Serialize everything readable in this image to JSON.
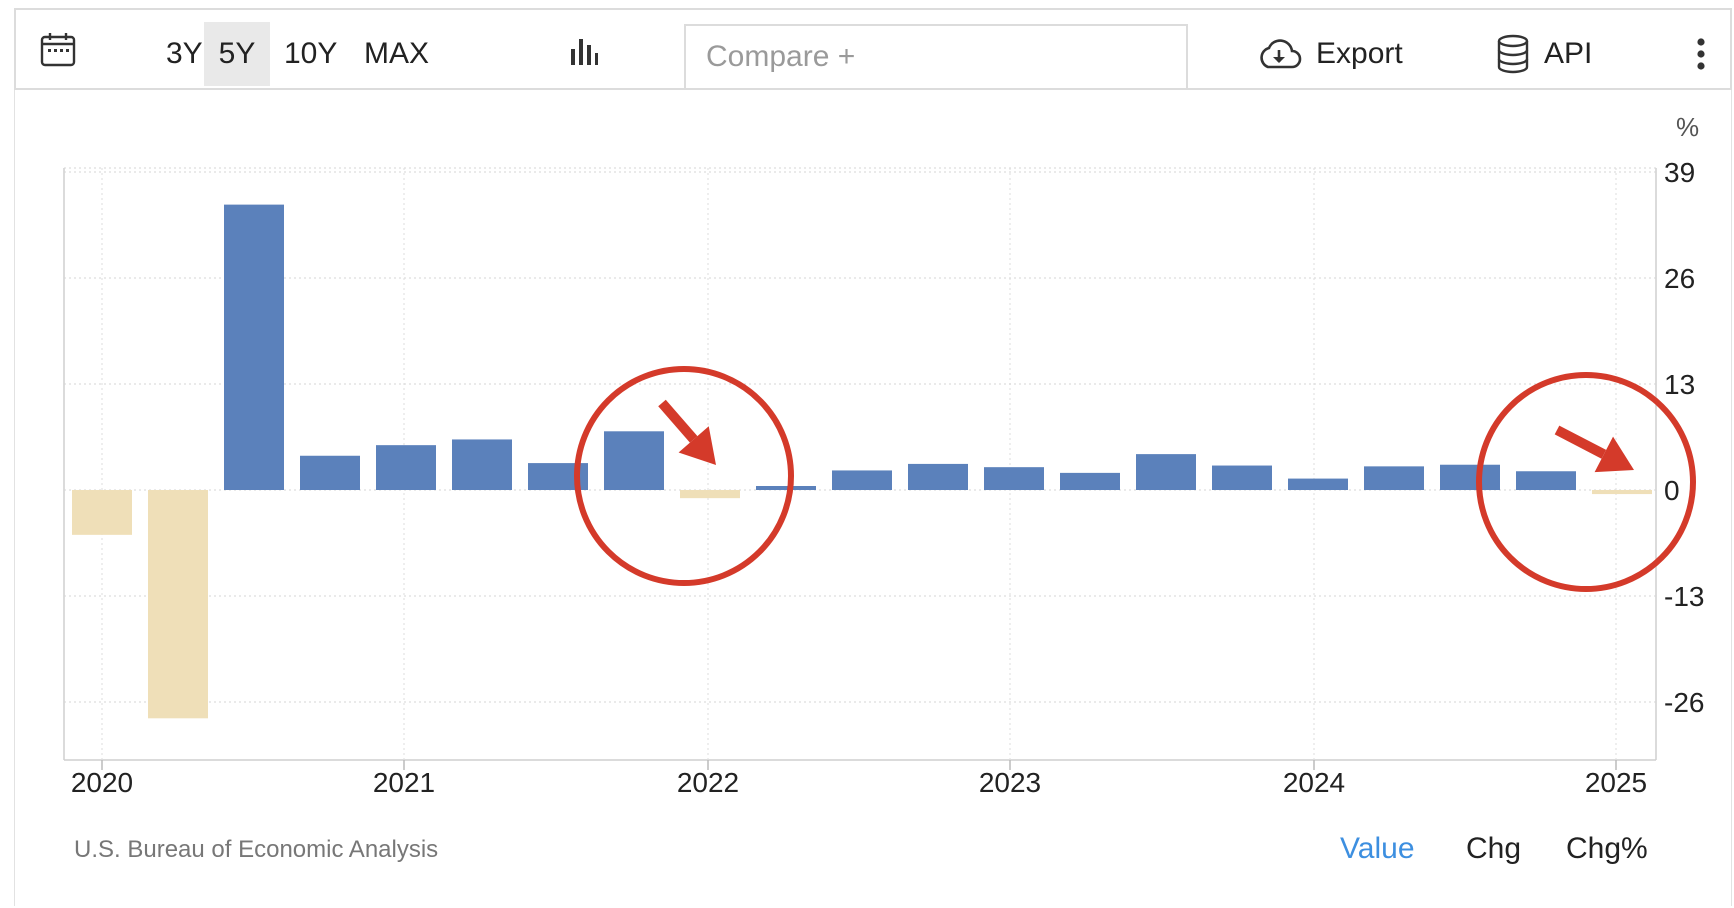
{
  "toolbar": {
    "ranges": [
      "3Y",
      "5Y",
      "10Y",
      "MAX"
    ],
    "active_range": "5Y",
    "compare_placeholder": "Compare +",
    "export_label": "Export",
    "api_label": "API",
    "icons": [
      "calendar-icon",
      "bar-chart-icon",
      "cloud-download-icon",
      "database-icon",
      "more-vertical-icon"
    ]
  },
  "footer": {
    "source": "U.S. Bureau of Economic Analysis",
    "views": [
      "Value",
      "Chg",
      "Chg%"
    ],
    "active_view": "Value"
  },
  "colors": {
    "positive": "#5b81bb",
    "negative": "#efdfb8",
    "active_link": "#3d8fe0",
    "annotation": "#d43a2a"
  },
  "chart_data": {
    "type": "bar",
    "unit": "%",
    "x": [
      "2020-Q1",
      "2020-Q2",
      "2020-Q3",
      "2020-Q4",
      "2021-Q1",
      "2021-Q2",
      "2021-Q3",
      "2021-Q4",
      "2022-Q1",
      "2022-Q2",
      "2022-Q3",
      "2022-Q4",
      "2023-Q1",
      "2023-Q2",
      "2023-Q3",
      "2023-Q4",
      "2024-Q1",
      "2024-Q2",
      "2024-Q3",
      "2024-Q4",
      "2025-Q1"
    ],
    "values": [
      -5.5,
      -28.0,
      35.0,
      4.2,
      5.5,
      6.2,
      3.3,
      7.2,
      -1.0,
      0.3,
      2.4,
      3.2,
      2.8,
      2.1,
      4.4,
      3.0,
      1.4,
      2.9,
      3.1,
      2.3,
      -0.5
    ],
    "ylim": [
      -33,
      39
    ],
    "yticks": [
      39,
      26,
      13,
      0,
      -13,
      -26
    ],
    "xticks": [
      "2020",
      "2021",
      "2022",
      "2023",
      "2024",
      "2025"
    ],
    "grid": true,
    "annotations": [
      "circle-arrow around 2022-Q1",
      "circle-arrow around 2025-Q1"
    ]
  }
}
